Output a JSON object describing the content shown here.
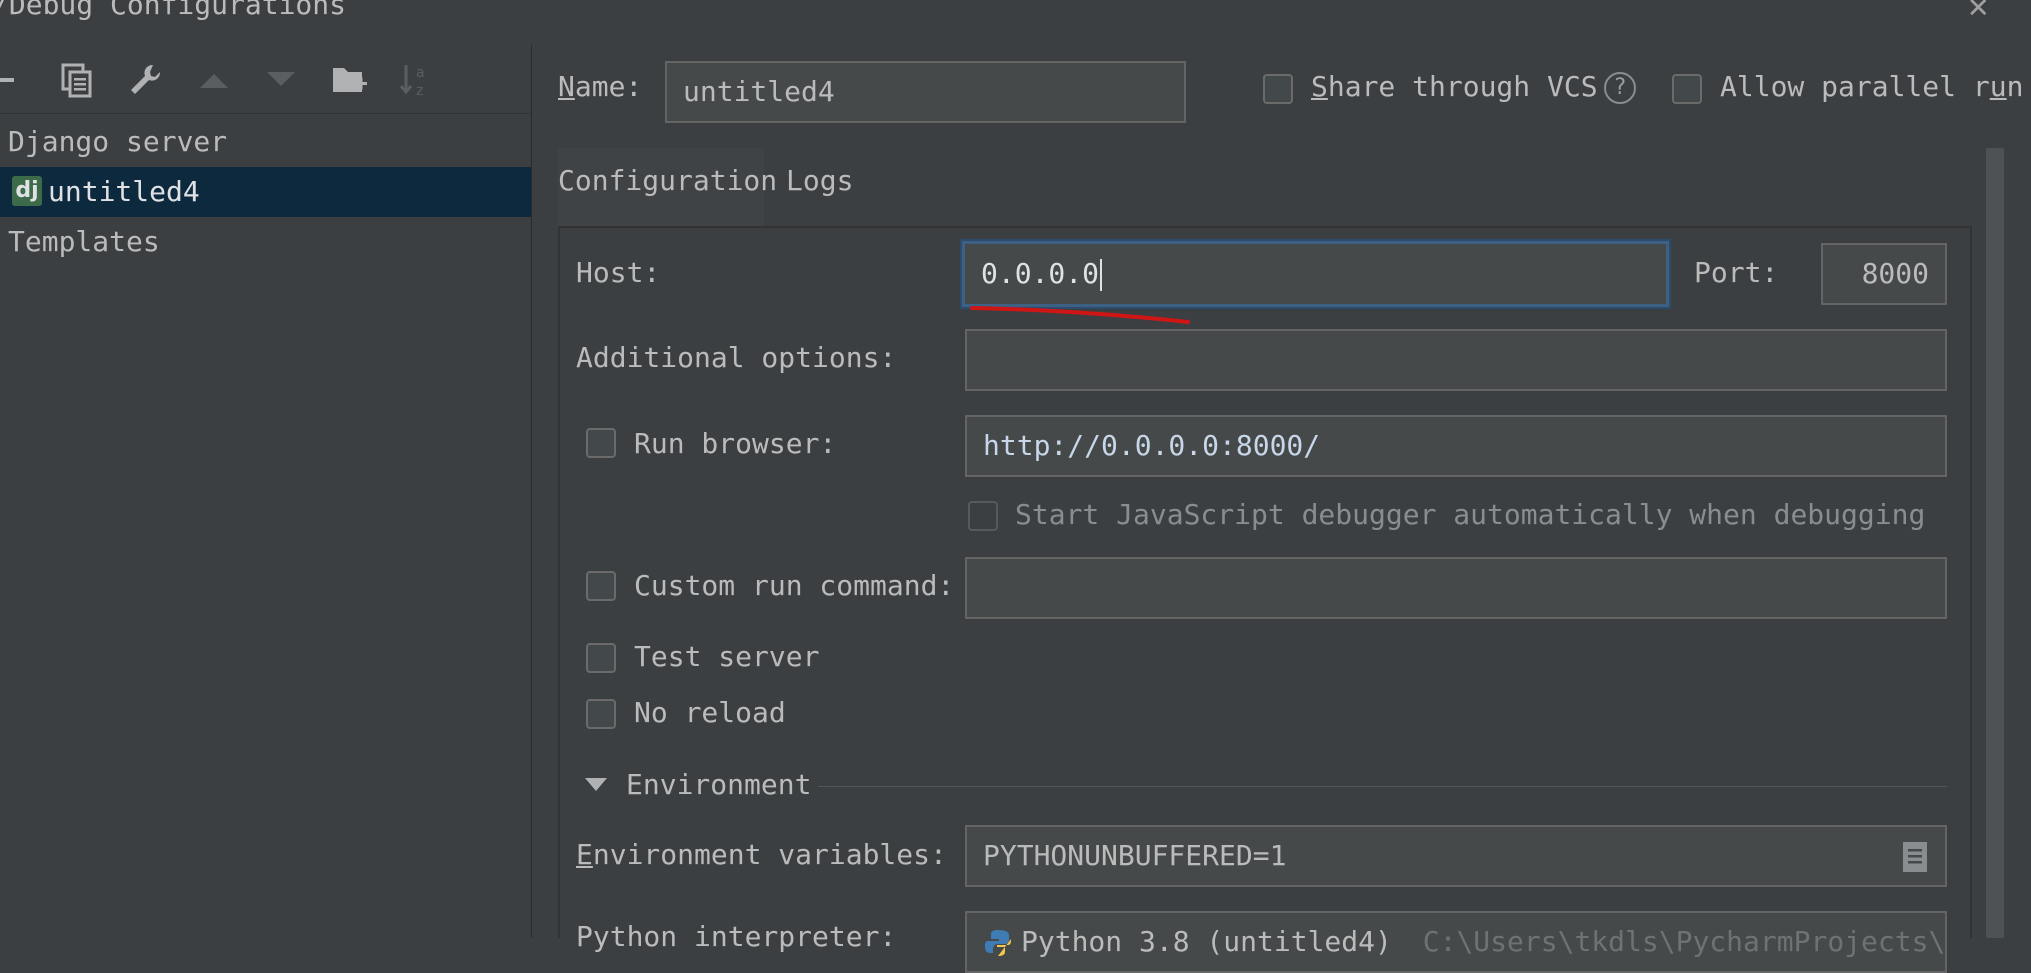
{
  "window": {
    "title": "/Debug Configurations",
    "close_label": "✕"
  },
  "toolbar": {
    "icons": [
      "remove-icon",
      "copy-icon",
      "wrench-icon",
      "move-up-icon",
      "move-down-icon",
      "new-folder-icon",
      "sort-alpha-icon"
    ]
  },
  "tree": {
    "group_label": "Django server",
    "item_badge": "dj",
    "item_label": "untitled4",
    "templates_label": "Templates"
  },
  "header": {
    "name_label_prefix": "N",
    "name_label_rest": "ame:",
    "name_value": "untitled4",
    "share_vcs_prefix": "S",
    "share_vcs_rest": "hare through VCS",
    "help_glyph": "?",
    "allow_parallel_pre": "Allow parallel r",
    "allow_parallel_u": "u",
    "allow_parallel_post": "n"
  },
  "tabs": [
    {
      "label": "Configuration",
      "active": true
    },
    {
      "label": "Logs",
      "active": false
    }
  ],
  "form": {
    "host_label": "Host:",
    "host_value": "0.0.0.0",
    "port_label": "Port:",
    "port_value": "8000",
    "additional_options_label": "Additional options:",
    "additional_options_value": "",
    "run_browser_label": "Run browser:",
    "run_browser_url": "http://0.0.0.0:8000/",
    "js_debugger_label": "Start JavaScript debugger automatically when debugging",
    "custom_run_label": "Custom run command:",
    "custom_run_value": "",
    "test_server_label": "Test server",
    "no_reload_label": "No reload",
    "environment_section": "Environment",
    "env_vars_label_prefix": "E",
    "env_vars_label_rest": "nvironment variables:",
    "env_vars_value": "PYTHONUNBUFFERED=1",
    "python_interpreter_label": "Python interpreter:",
    "python_interpreter_value": "Python 3.8 (untitled4)",
    "python_interpreter_path": "C:\\Users\\tkdls\\PycharmProjects\\untit"
  },
  "colors": {
    "background": "#3c3f41",
    "selection": "#0d293e",
    "tab_underline": "#4a88c7",
    "focus_border": "#3d6185",
    "annotation_red": "#d01515",
    "url_text": "#c7d6e8",
    "django_badge": "#3d6b4a"
  }
}
